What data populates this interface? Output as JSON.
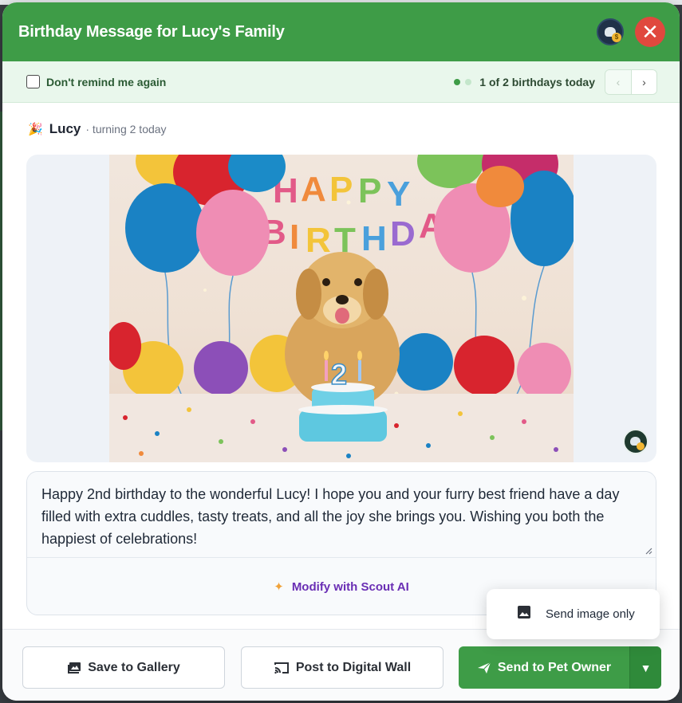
{
  "modal": {
    "title": "Birthday Message for Lucy's Family",
    "close_icon": "close-icon",
    "logo_icon": "app-logo-icon"
  },
  "subbar": {
    "remind_label": "Don't remind me again",
    "remind_checked": false,
    "counter": "1 of 2 birthdays today",
    "pager_prev": "‹",
    "pager_next": "›"
  },
  "pet": {
    "name": "Lucy",
    "age_text": "· turning 2 today"
  },
  "image": {
    "caption_letters": "HAPPY BIRTHDAY",
    "cake_number": "2"
  },
  "message": {
    "text": "Happy 2nd birthday to the wonderful Lucy! I hope you and your furry best friend have a day filled with extra cuddles, tasty treats, and all the joy she brings you. Wishing you both the happiest of celebrations!",
    "modify_label": "Modify with Scout AI"
  },
  "footer": {
    "save_label": "Save to Gallery",
    "wall_label": "Post to Digital Wall",
    "send_label": "Send to Pet Owner",
    "dropdown_arrow": "▼"
  },
  "popover": {
    "option_label": "Send image only"
  },
  "colors": {
    "brand_green": "#3e9c47",
    "close_red": "#e0483e",
    "ai_purple": "#6a2eb4"
  }
}
